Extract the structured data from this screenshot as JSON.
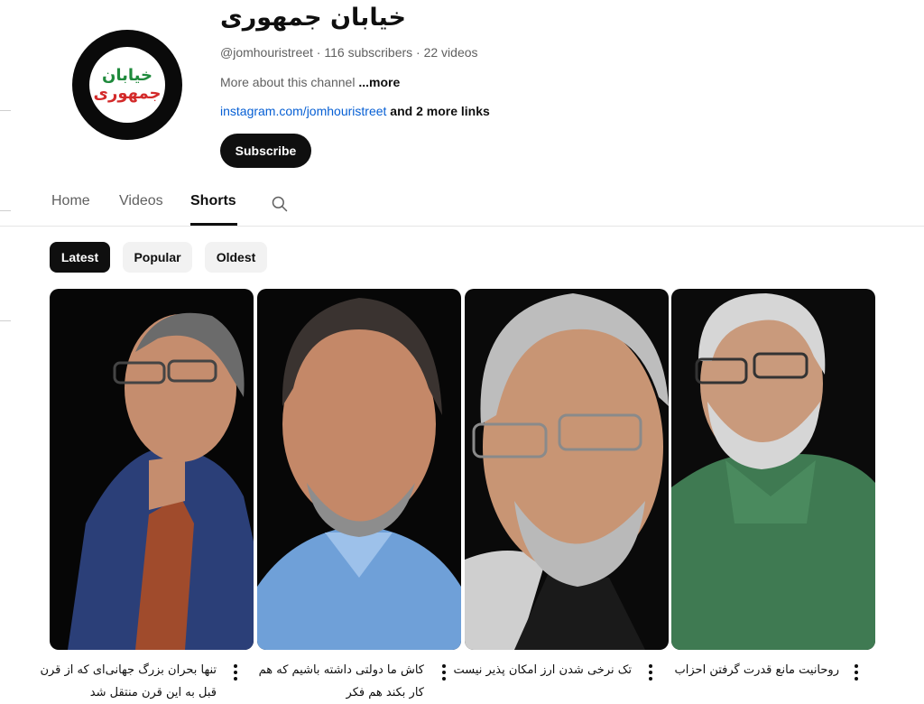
{
  "channel": {
    "title": "خیابان جمهوری",
    "logo_line1": "خیابان",
    "logo_line2": "جمهوری",
    "meta": "@jomhouristreet · 116 subscribers · 22 videos",
    "about": "More about this channel",
    "about_more": "...more",
    "link": "instagram.com/jomhouristreet",
    "more_links": "and 2 more links",
    "subscribe_label": "Subscribe"
  },
  "tabs": [
    {
      "label": "Home",
      "active": false
    },
    {
      "label": "Videos",
      "active": false
    },
    {
      "label": "Shorts",
      "active": true
    }
  ],
  "chips": [
    {
      "label": "Latest",
      "active": true
    },
    {
      "label": "Popular",
      "active": false
    },
    {
      "label": "Oldest",
      "active": false
    }
  ],
  "shorts": [
    {
      "caption": "تنها بحران بزرگ جهانی‌ای که از قرن قبل به این قرن منتقل شد",
      "jacket_color": "#2b3f78",
      "shirt_color": "#a04b2c",
      "skin_color": "#c58d6e",
      "hair_color": "#6b6b6b"
    },
    {
      "caption": "کاش ما دولتی داشته باشیم که هم کار بکند هم فکر",
      "jacket_color": "#6fa0d8",
      "shirt_color": "#9dc1ea",
      "skin_color": "#c48868",
      "hair_color": "#3a3330"
    },
    {
      "caption": "تک نرخی شدن ارز امکان پذیر نیست",
      "jacket_color": "#1a1a1a",
      "shirt_color": "#cfcfcf",
      "skin_color": "#c89574",
      "hair_color": "#bdbdbd"
    },
    {
      "caption": "روحانیت مانع قدرت گرفتن احزاب",
      "jacket_color": "#3f7a52",
      "shirt_color": "#4a8a5e",
      "skin_color": "#c99a7c",
      "hair_color": "#d6d6d6"
    }
  ],
  "icons": {
    "search": "search-icon",
    "more": "more-vert-icon"
  }
}
